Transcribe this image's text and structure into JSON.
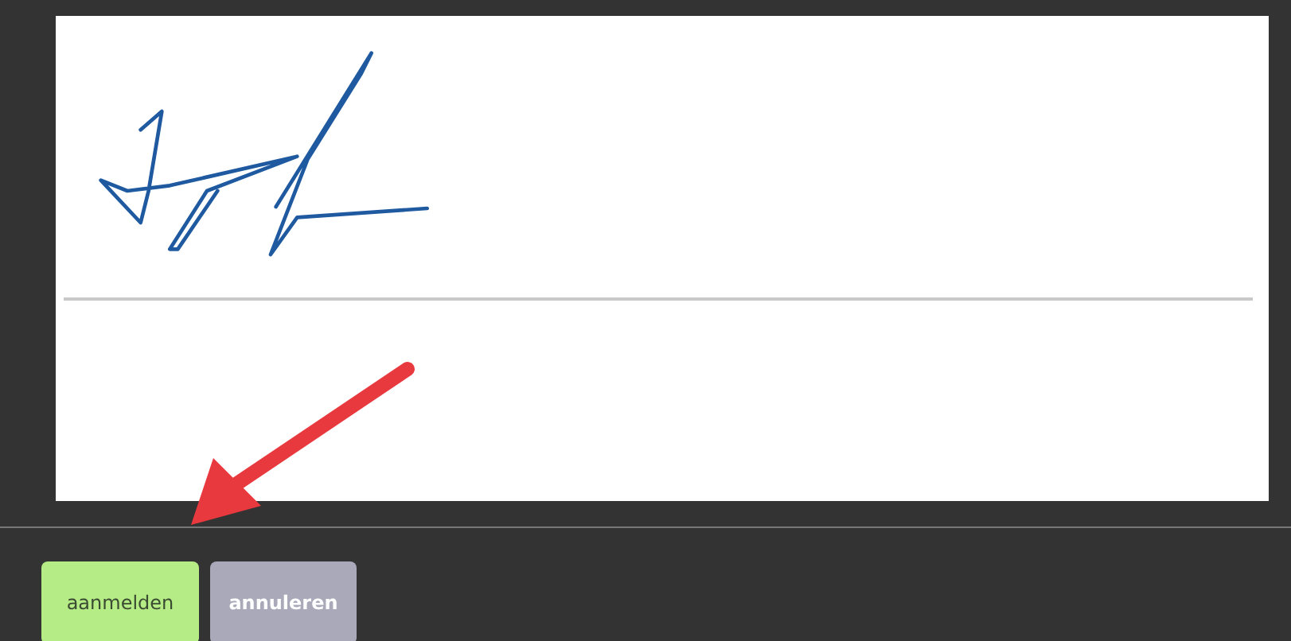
{
  "buttons": [
    {
      "label": "aanmelden",
      "kind": "primary"
    },
    {
      "label": "annuleren",
      "kind": "secondary"
    }
  ]
}
